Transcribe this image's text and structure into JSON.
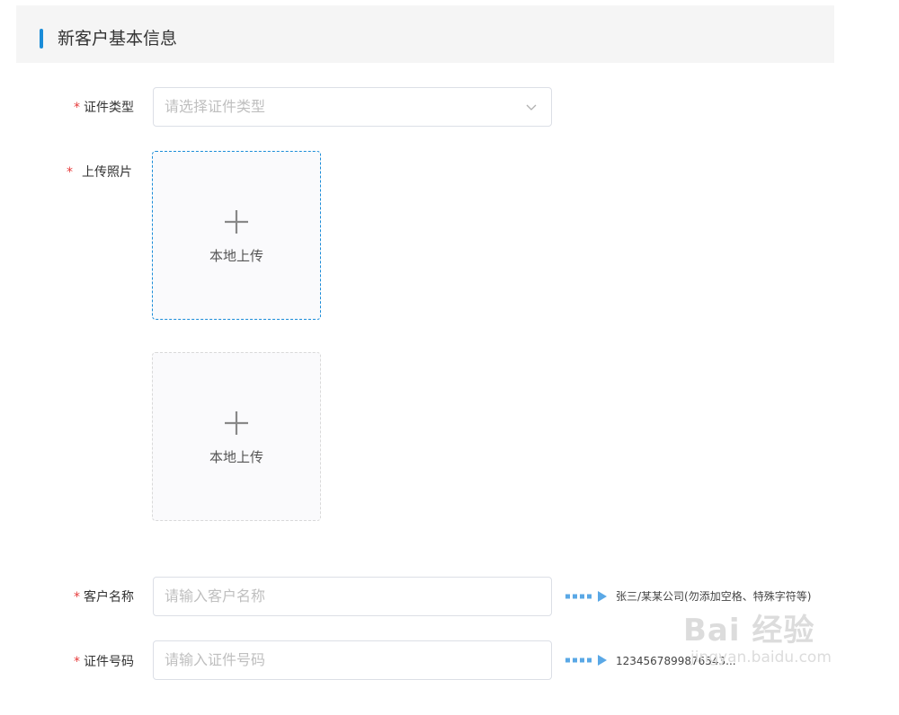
{
  "header": {
    "title": "新客户基本信息",
    "accent_color": "#1a8cd8"
  },
  "required_mark": "*",
  "form": {
    "id_type": {
      "label": "证件类型",
      "placeholder": "请选择证件类型"
    },
    "photo": {
      "label": "上传照片",
      "slots": [
        {
          "text": "本地上传"
        },
        {
          "text": "本地上传"
        }
      ]
    },
    "customer_name": {
      "label": "客户名称",
      "placeholder": "请输入客户名称",
      "hint": "张三/某某公司(勿添加空格、特殊字符等)"
    },
    "id_number": {
      "label": "证件号码",
      "placeholder": "请输入证件号码",
      "hint": "1234567899876543..."
    }
  },
  "icons": {
    "plus": "plus-icon",
    "chevron": "chevron-down-icon",
    "arrow": "dotted-arrow-icon"
  },
  "watermark": {
    "logo": "Bai 经验",
    "url": "jingyan.baidu.com"
  }
}
